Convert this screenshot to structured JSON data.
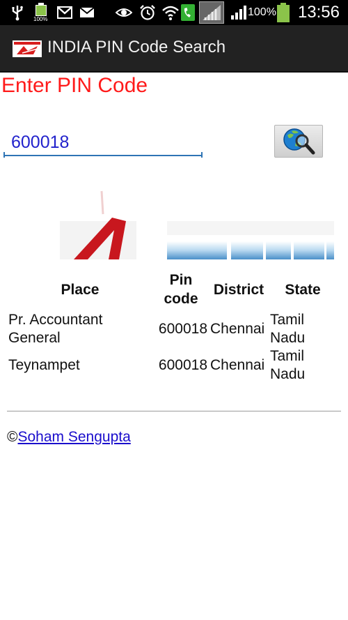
{
  "status_bar": {
    "time": "13:56",
    "battery_percent": "100%",
    "small_battery_label": "100%",
    "icons": [
      "usb-icon",
      "battery-small-icon",
      "gmail-icon",
      "mail-icon",
      "eye-icon",
      "alarm-icon",
      "wifi-icon",
      "call-icon",
      "signal-weak-icon",
      "signal-icon",
      "battery-icon"
    ]
  },
  "app_bar": {
    "title": "INDIA PIN Code Search",
    "logo": "india-post-logo-icon"
  },
  "form": {
    "label": "Enter PIN Code",
    "pin_value": "600018",
    "search_button_icon": "globe-search-icon"
  },
  "results": {
    "headers": {
      "place": "Place",
      "pin_line1": "Pin",
      "pin_line2": "code",
      "district": "District",
      "state": "State"
    },
    "rows": [
      {
        "place_line1": "Pr. Accountant",
        "place_line2": "General",
        "pin": "600018",
        "district": "Chennai",
        "state_line1": "Tamil",
        "state_line2": "Nadu"
      },
      {
        "place_line1": "Teynampet",
        "place_line2": "",
        "pin": "600018",
        "district": "Chennai",
        "state_line1": "Tamil",
        "state_line2": "Nadu"
      }
    ]
  },
  "footer": {
    "copyright": "©",
    "author_link": "Soham Sengupta"
  },
  "colors": {
    "label_red": "#ff1a1a",
    "input_underline": "#2e74b5",
    "action_bar": "#222222",
    "link": "#1a0dcc"
  }
}
